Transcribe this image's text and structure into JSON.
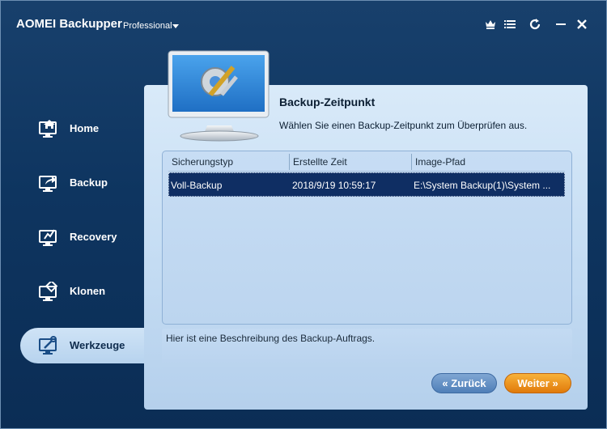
{
  "app": {
    "title": "AOMEI Backupper",
    "edition": "Professional"
  },
  "titlebar_icons": [
    "crown-icon",
    "menu-icon",
    "refresh-icon",
    "minimize-icon",
    "close-icon"
  ],
  "sidebar": {
    "items": [
      {
        "label": "Home",
        "icon": "home-icon",
        "active": false
      },
      {
        "label": "Backup",
        "icon": "backup-icon",
        "active": false
      },
      {
        "label": "Recovery",
        "icon": "recovery-icon",
        "active": false
      },
      {
        "label": "Klonen",
        "icon": "clone-icon",
        "active": false
      },
      {
        "label": "Werkzeuge",
        "icon": "tools-icon",
        "active": true
      }
    ]
  },
  "main": {
    "title": "Backup-Zeitpunkt",
    "subtitle": "Wählen Sie einen Backup-Zeitpunkt zum Überprüfen aus.",
    "table": {
      "columns": [
        "Sicherungstyp",
        "Erstellte Zeit",
        "Image-Pfad"
      ],
      "rows": [
        {
          "type": "Voll-Backup",
          "time": "2018/9/19 10:59:17",
          "path": "E:\\System Backup(1)\\System ...",
          "selected": true
        }
      ]
    },
    "description": "Hier ist eine Beschreibung des Backup-Auftrags."
  },
  "buttons": {
    "back_label": "Zurück",
    "next_label": "Weiter"
  },
  "colors": {
    "background": "#0e3560",
    "panel": "#c4dcf3",
    "selected_row": "#0f2e63",
    "next_button": "#f39c1f",
    "back_button": "#5f8dc4"
  }
}
